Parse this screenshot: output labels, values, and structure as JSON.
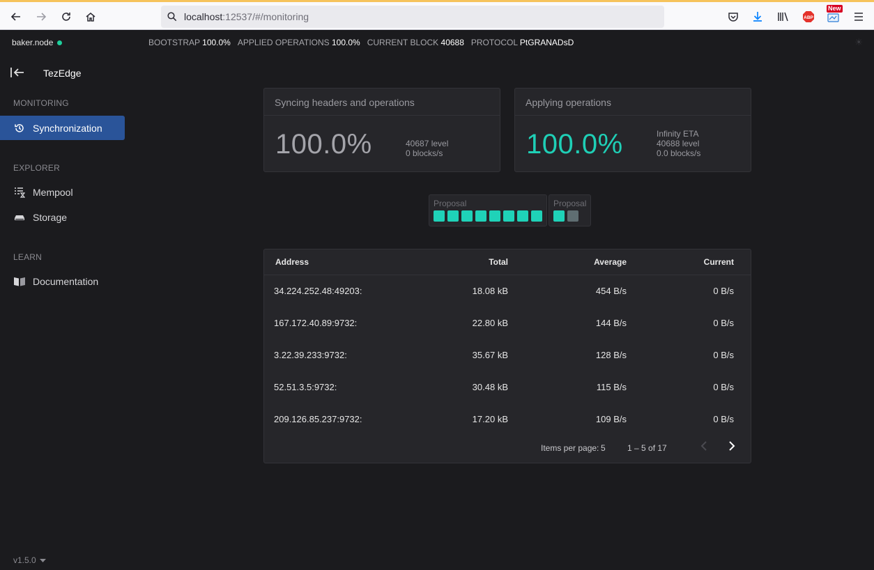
{
  "browser": {
    "url_host": "localhost",
    "url_rest": ":12537/#/monitoring",
    "new_badge": "New"
  },
  "status": {
    "node_name": "baker.node",
    "items": [
      {
        "label": "BOOTSTRAP",
        "value": "100.0%"
      },
      {
        "label": "APPLIED OPERATIONS",
        "value": "100.0%"
      },
      {
        "label": "CURRENT BLOCK",
        "value": "40688"
      },
      {
        "label": "PROTOCOL",
        "value": "PtGRANADsD"
      }
    ]
  },
  "sidebar": {
    "title": "TezEdge",
    "sections": {
      "monitoring": "MONITORING",
      "explorer": "EXPLORER",
      "learn": "LEARN"
    },
    "items": {
      "synchronization": "Synchronization",
      "mempool": "Mempool",
      "storage": "Storage",
      "documentation": "Documentation"
    },
    "version": "v1.5.0"
  },
  "cards": {
    "syncing": {
      "title": "Syncing headers and operations",
      "percent": "100.0%",
      "level": "40687 level",
      "rate": "0 blocks/s"
    },
    "applying": {
      "title": "Applying operations",
      "percent": "100.0%",
      "eta": "Infinity ETA",
      "level": "40688 level",
      "rate": "0.0 blocks/s"
    }
  },
  "rounds": [
    {
      "label": "Proposal",
      "squares": [
        "teal",
        "teal",
        "teal",
        "teal",
        "teal",
        "teal",
        "teal",
        "teal"
      ]
    },
    {
      "label": "Proposal",
      "squares": [
        "teal",
        "grey"
      ]
    }
  ],
  "peers": {
    "headers": {
      "address": "Address",
      "total": "Total",
      "average": "Average",
      "current": "Current"
    },
    "rows": [
      {
        "address": "34.224.252.48:49203:",
        "total": "18.08 kB",
        "average": "454 B/s",
        "current": "0 B/s"
      },
      {
        "address": "167.172.40.89:9732:",
        "total": "22.80 kB",
        "average": "144 B/s",
        "current": "0 B/s"
      },
      {
        "address": "3.22.39.233:9732:",
        "total": "35.67 kB",
        "average": "128 B/s",
        "current": "0 B/s"
      },
      {
        "address": "52.51.3.5:9732:",
        "total": "30.48 kB",
        "average": "115 B/s",
        "current": "0 B/s"
      },
      {
        "address": "209.126.85.237:9732:",
        "total": "17.20 kB",
        "average": "109 B/s",
        "current": "0 B/s"
      }
    ],
    "paginator": {
      "items_per_page_label": "Items per page:",
      "page_size": "5",
      "range": "1 – 5 of 17"
    }
  },
  "colors": {
    "accent": "#2a5499",
    "teal": "#1fd2b8",
    "node_status": "#1fcf9c"
  }
}
